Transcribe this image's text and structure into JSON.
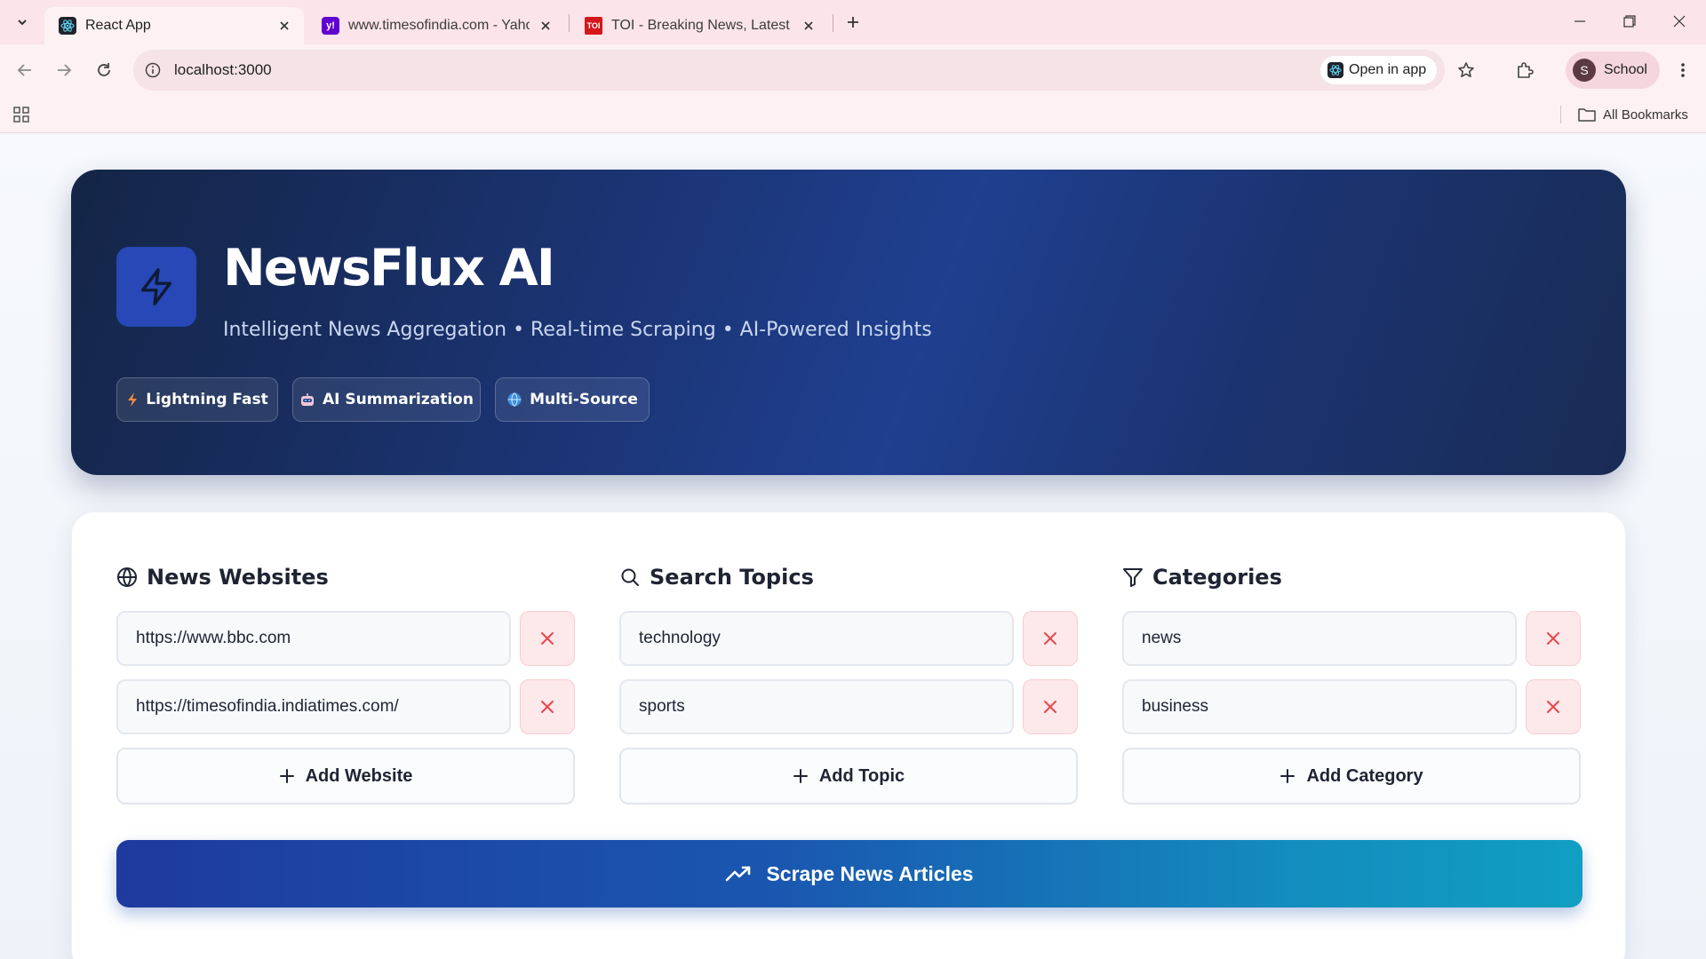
{
  "browser": {
    "tabs": [
      {
        "title": "React App",
        "favicon": "react-icon"
      },
      {
        "title": "www.timesofindia.com - Yahoo",
        "favicon": "yahoo-icon",
        "favicon_text": "y!"
      },
      {
        "title": "TOI - Breaking News, Latest Ne",
        "favicon": "toi-icon",
        "favicon_text": "TOI"
      }
    ],
    "url": "localhost:3000",
    "open_in_app": "Open in app",
    "profile_initial": "S",
    "profile_name": "School",
    "all_bookmarks": "All Bookmarks"
  },
  "hero": {
    "title": "NewsFlux AI",
    "subtitle": "Intelligent News Aggregation • Real-time Scraping • AI-Powered Insights",
    "badges": [
      {
        "label": "Lightning Fast",
        "icon": "lightning-icon"
      },
      {
        "label": "AI Summarization",
        "icon": "robot-icon"
      },
      {
        "label": "Multi-Source",
        "icon": "globe-icon"
      }
    ]
  },
  "config": {
    "websites": {
      "heading": "News Websites",
      "icon": "globe-icon",
      "items": [
        "https://www.bbc.com",
        "https://timesofindia.indiatimes.com/"
      ],
      "add_label": "Add Website"
    },
    "topics": {
      "heading": "Search Topics",
      "icon": "search-icon",
      "items": [
        "technology",
        "sports"
      ],
      "add_label": "Add Topic"
    },
    "categories": {
      "heading": "Categories",
      "icon": "filter-icon",
      "items": [
        "news",
        "business"
      ],
      "add_label": "Add Category"
    },
    "scrape_label": "Scrape News Articles"
  },
  "colors": {
    "accent": "#1e3a9f",
    "accent_end": "#109fc2",
    "delete_red": "#e5484d",
    "hero_dark": "#142546"
  }
}
